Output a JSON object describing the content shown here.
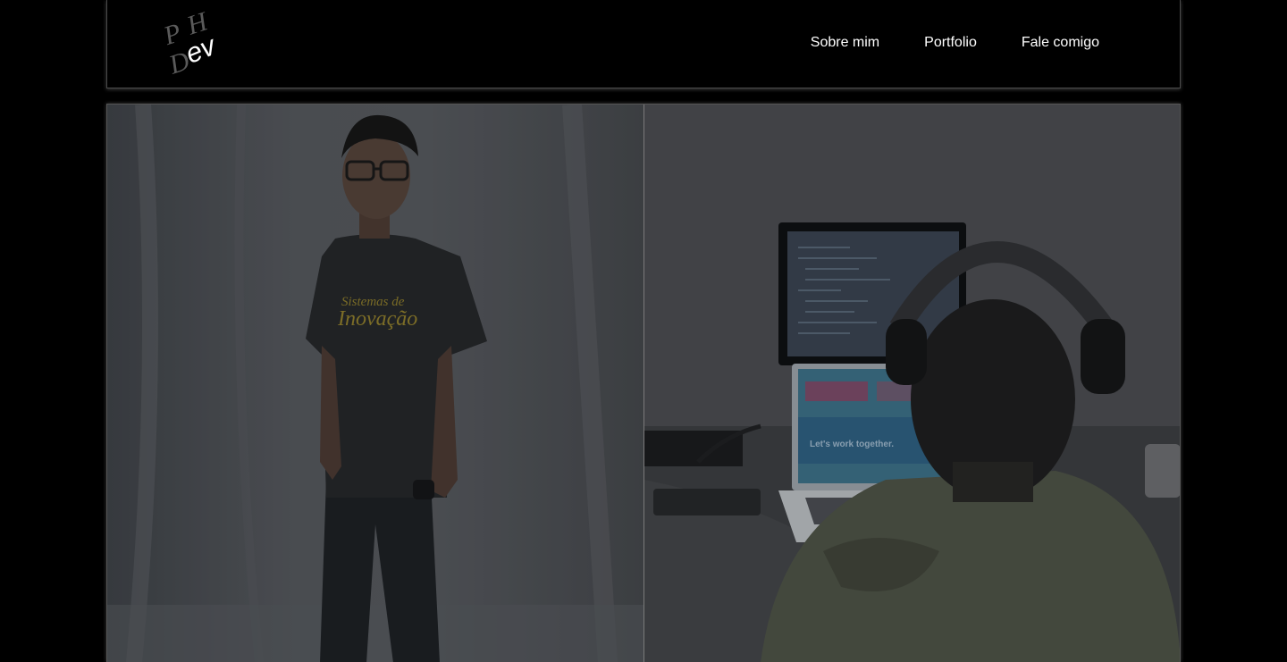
{
  "header": {
    "logo": {
      "letters_top": [
        "P",
        "H"
      ],
      "letter_d": "D",
      "letters_ev": "ev"
    },
    "nav": [
      {
        "label": "Sobre mim"
      },
      {
        "label": "Portfolio"
      },
      {
        "label": "Fale comigo"
      }
    ]
  },
  "gallery": {
    "left_photo": {
      "shirt_text_line1": "Sistemas de",
      "shirt_text_line2": "Inovação"
    },
    "right_photo": {
      "screen_text": "Let's work together."
    }
  },
  "colors": {
    "background": "#000000",
    "nav_text": "#ffffff",
    "logo_grey": "#5a5a5a"
  }
}
